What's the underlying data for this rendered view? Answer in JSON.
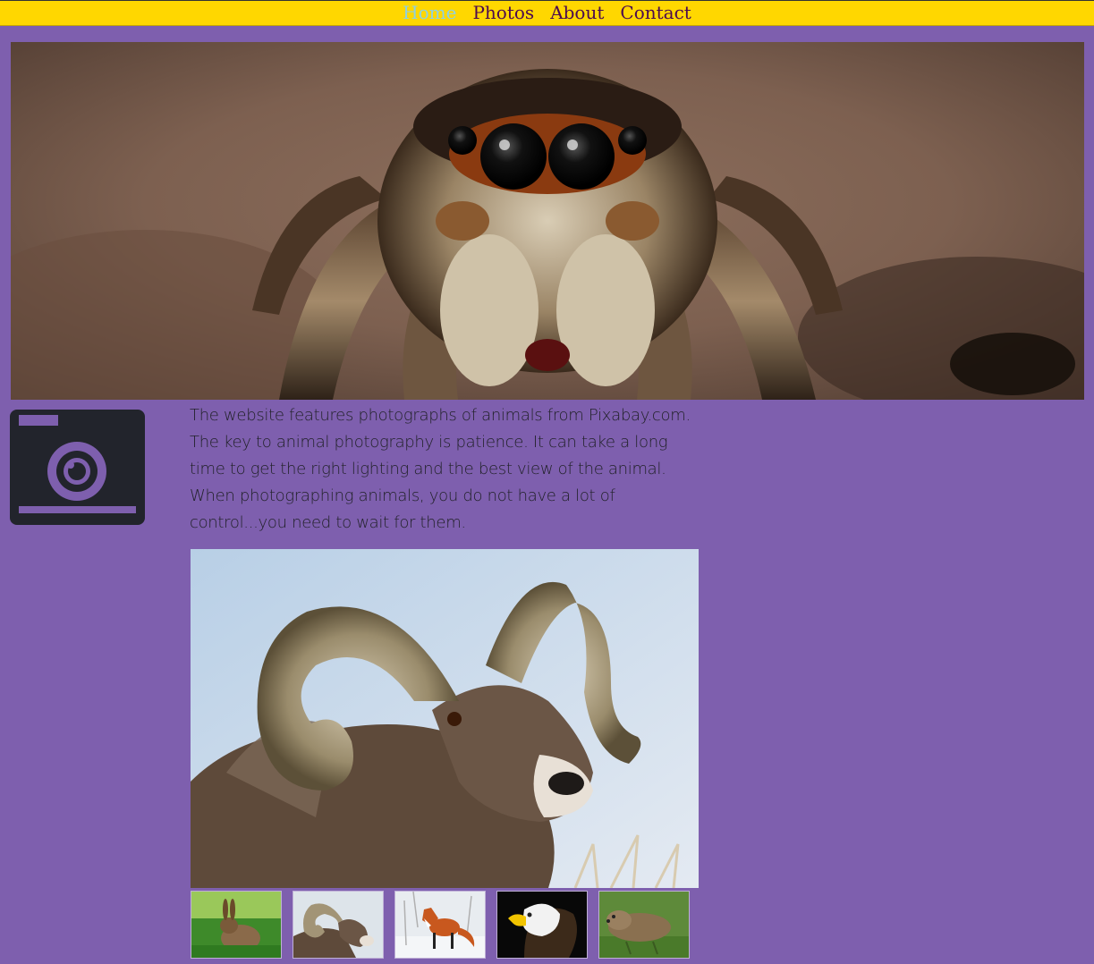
{
  "nav": {
    "items": [
      {
        "label": "Home",
        "active": true
      },
      {
        "label": "Photos",
        "active": false
      },
      {
        "label": "About",
        "active": false
      },
      {
        "label": "Contact",
        "active": false
      }
    ]
  },
  "intro": {
    "text": "The website features photographs of animals from Pixabay.com. The key to animal photography is patience. It can take a long time to get the right lighting and the best view of the animal. When photographing animals, you do not have a lot of control...you need to wait for them."
  },
  "images": {
    "hero": "jumping spider close-up",
    "main": "bighorn ram",
    "thumbs": [
      "rabbit",
      "bighorn ram",
      "red fox",
      "bald eagle",
      "otter"
    ]
  },
  "colors": {
    "background": "#7e5fae",
    "nav_bar": "#ffd700",
    "nav_link": "#4b0a50",
    "nav_active": "#8fd1e0",
    "text": "#22222a"
  },
  "icons": {
    "logo": "camera-icon"
  }
}
